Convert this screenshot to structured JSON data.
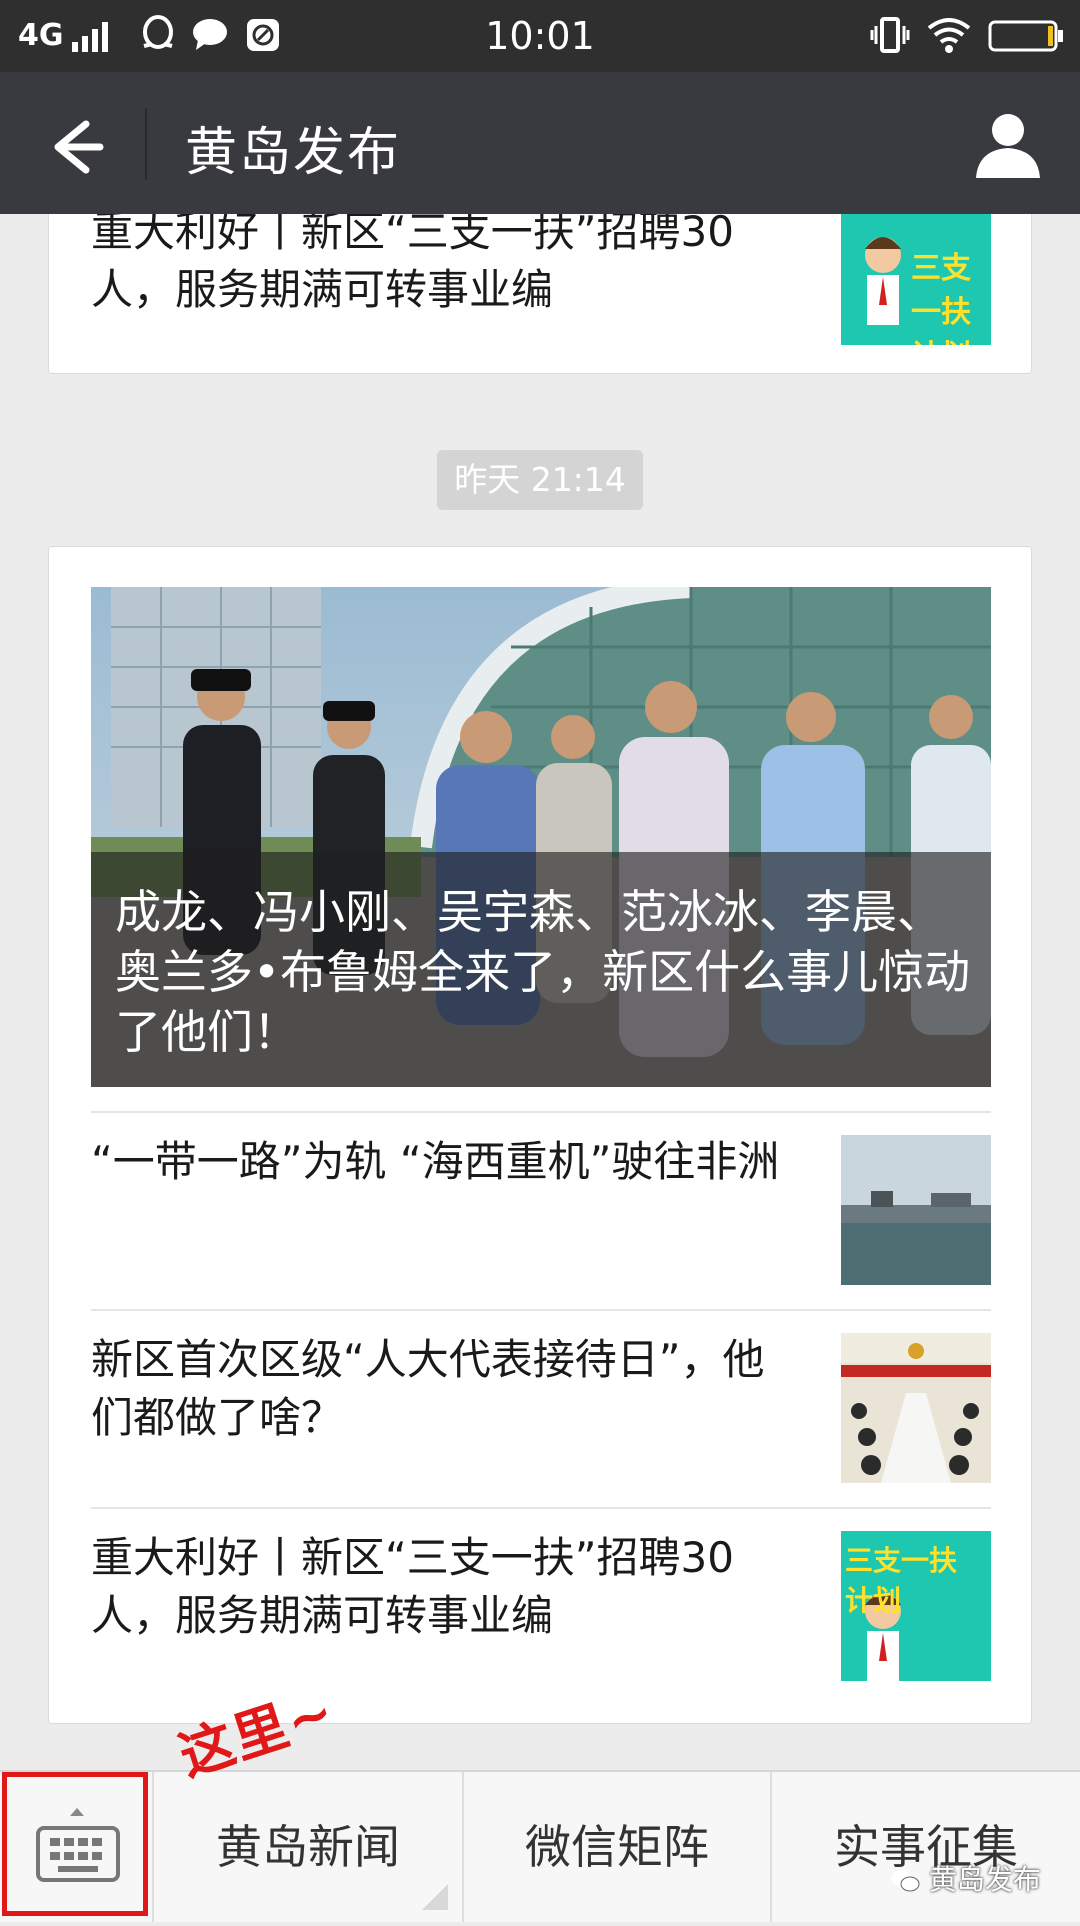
{
  "status_bar": {
    "network": "4G",
    "time": "10:01"
  },
  "header": {
    "title": "黄岛发布"
  },
  "timestamp": "昨天 21:14",
  "top_card": {
    "title": "重大利好丨新区“三支一扶”招聘30人，服务期满可转事业编",
    "thumb_text": "三支一扶 计划"
  },
  "main_card": {
    "hero_title": "成龙、冯小刚、吴宇森、范冰冰、李晨、奥兰多•布鲁姆全来了，新区什么事儿惊动了他们！",
    "articles": [
      {
        "title": "“一带一路”为轨 “海西重机”驶往非洲"
      },
      {
        "title": "新区首次区级“人大代表接待日”，他们都做了啥？"
      },
      {
        "title": "重大利好丨新区“三支一扶”招聘30人，服务期满可转事业编",
        "thumb_text": "三支一扶 计划"
      }
    ]
  },
  "bottom_menu": {
    "items": [
      "黄岛新闻",
      "微信矩阵",
      "实事征集"
    ]
  },
  "annotation": "这里~",
  "watermark": "黄岛发布",
  "colors": {
    "statusbar": "#2f2f2f",
    "titlebar": "#393a3f",
    "highlight": "#e01818"
  }
}
